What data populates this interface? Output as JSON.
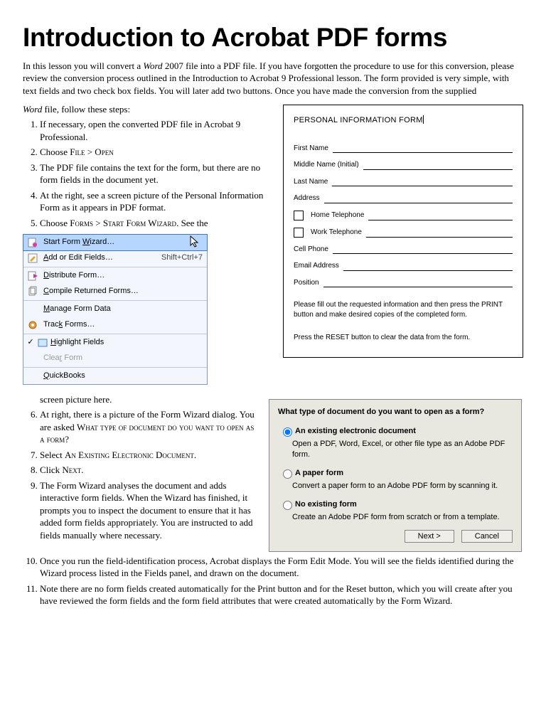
{
  "title": "Introduction to Acrobat PDF forms",
  "intro_a": "In this lesson you will convert a ",
  "intro_word": "Word",
  "intro_b": " 2007 file into a PDF file. If you have forgotten the procedure to use for this conversion, please review the conversion process outlined in the Introduction to Acrobat 9 Professional lesson. The form provided is very simple, with text fields and two check box fields. You will later add two buttons. Once you have made the conversion from the supplied",
  "intro_word2": "Word",
  "intro_c": " file, follow these steps:",
  "steps": {
    "s1": "If necessary, open the converted PDF file in Acrobat 9 Professional.",
    "s2a": "Choose ",
    "s2b": "File > Open",
    "s3": "The PDF file contains the text for the form, but there are no form fields in the document yet.",
    "s4": "At the right, see a screen picture of the Personal Information Form as it appears in PDF format.",
    "s5a": "Choose ",
    "s5b": "Forms > Start Form Wizard",
    "s5c": ". See the",
    "s5_after": "screen picture here.",
    "s6a": "At right, there is a picture of the Form Wizard dialog. You are asked ",
    "s6b": "What type of document do you want to open as a form?",
    "s7a": "Select ",
    "s7b": "An Existing Electronic Document.",
    "s8a": "Click ",
    "s8b": "Next.",
    "s9": "The Form Wizard analyses the document and adds interactive form fields. When the Wizard has finished, it prompts you to inspect the document to ensure that it has added form fields appropriately. You are instructed to add fields manually where necessary.",
    "s10": "Once you run the field-identification process, Acrobat displays the Form Edit Mode. You will see the fields identified during the Wizard process listed in the Fields panel, and drawn on the document.",
    "s11": "Note there are no form fields created automatically for the Print button and for the Reset button, which you will create after you have reviewed the form fields and the form field attributes that were created automatically by the Form Wizard."
  },
  "menu": {
    "start": "Start Form Wizard…",
    "add": "Add or Edit Fields…",
    "add_sc": "Shift+Ctrl+7",
    "dist": "Distribute Form…",
    "compile": "Compile Returned Forms…",
    "manage": "Manage Form Data",
    "track": "Track Forms…",
    "highlight": "Highlight Fields",
    "clear": "Clear Form",
    "qb": "QuickBooks"
  },
  "pif": {
    "title": "PERSONAL INFORMATION FORM",
    "first": "First Name",
    "middle": "Middle Name (Initial)",
    "last": "Last Name",
    "address": "Address",
    "home": "Home Telephone",
    "work": "Work Telephone",
    "cell": "Cell Phone",
    "email": "Email Address",
    "position": "Position",
    "note1": "Please fill out the requested information and then press the PRINT button and make desired copies of the completed form.",
    "note2": "Press the RESET button to clear the data from the form."
  },
  "wizard": {
    "question": "What type of document do you want to open as a form?",
    "opt1": "An existing electronic document",
    "opt1_desc": "Open a PDF, Word, Excel, or other file type as an Adobe PDF form.",
    "opt2": "A paper form",
    "opt2_desc": "Convert a paper form to an Adobe PDF form by scanning it.",
    "opt3": "No existing form",
    "opt3_desc": "Create an Adobe PDF form from scratch or from a template.",
    "next": "Next >",
    "cancel": "Cancel"
  }
}
